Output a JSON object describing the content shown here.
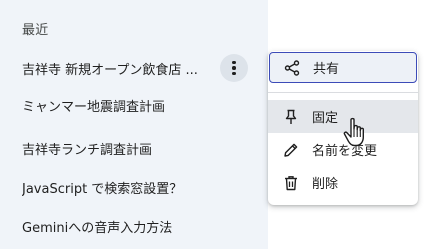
{
  "sidebar": {
    "section_label": "最近",
    "items": [
      {
        "label": "吉祥寺 新規オープン飲食店 ..."
      },
      {
        "label": "ミャンマー地震調査計画"
      },
      {
        "label": "吉祥寺ランチ調査計画"
      },
      {
        "label": "JavaScript で検索窓設置？"
      },
      {
        "label": "Geminiへの音声入力方法"
      }
    ],
    "kebab_icon": "more-vert-icon"
  },
  "menu": {
    "items": [
      {
        "label": "共有",
        "icon": "share-icon"
      },
      {
        "label": "固定",
        "icon": "pin-icon"
      },
      {
        "label": "名前を変更",
        "icon": "edit-icon"
      },
      {
        "label": "削除",
        "icon": "trash-icon"
      }
    ]
  },
  "colors": {
    "sidebar_bg": "#f0f4f9",
    "focus_border": "#3c4bb8",
    "hover_bg": "#e4e7eb",
    "text": "#1f1f1f"
  }
}
